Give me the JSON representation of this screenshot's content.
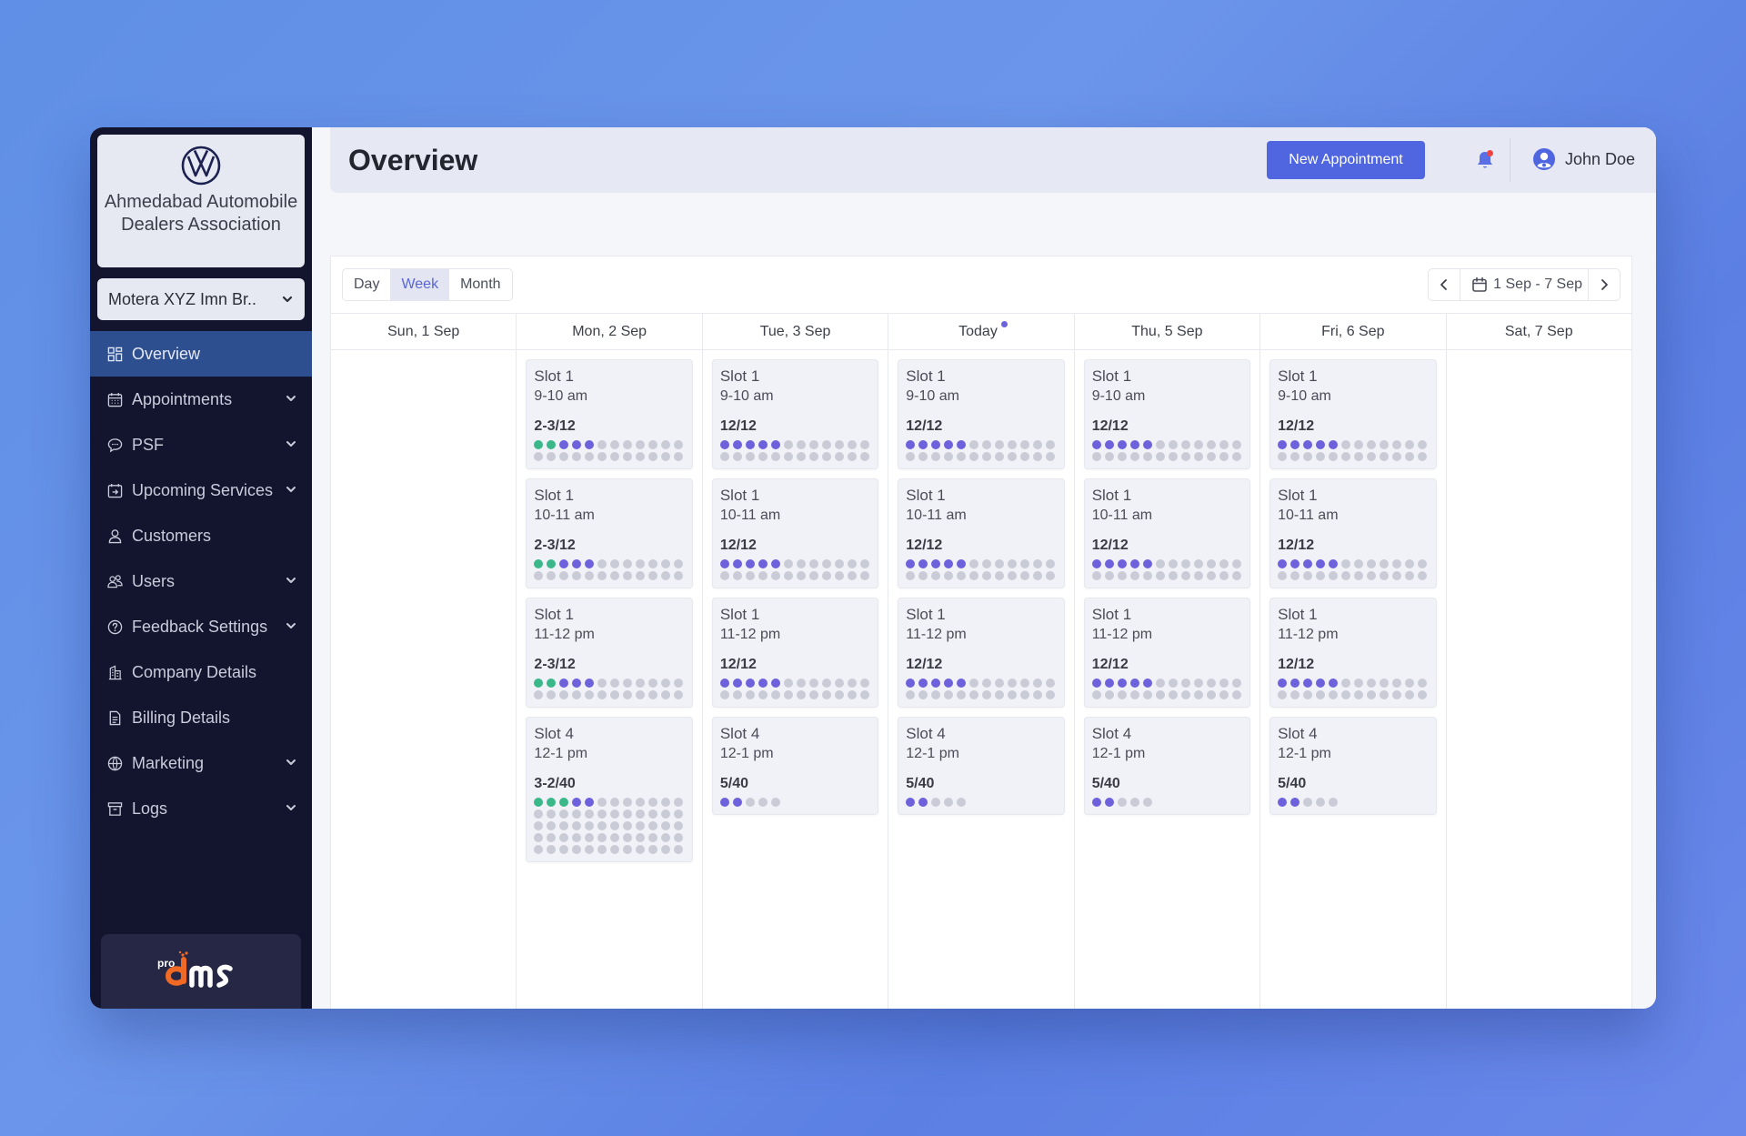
{
  "brand": {
    "logo_icon": "vw-logo-icon",
    "name": "Ahmedabad Automobile Dealers Association"
  },
  "branch_select": {
    "value": "Motera XYZ Imn Br.."
  },
  "sidebar": {
    "items": [
      {
        "label": "Overview",
        "icon": "grid-icon",
        "active": true,
        "has_submenu": false
      },
      {
        "label": "Appointments",
        "icon": "calendar-icon",
        "active": false,
        "has_submenu": true
      },
      {
        "label": "PSF",
        "icon": "chat-bubble-icon",
        "active": false,
        "has_submenu": true
      },
      {
        "label": "Upcoming Services",
        "icon": "calendar-arrow-icon",
        "active": false,
        "has_submenu": true
      },
      {
        "label": "Customers",
        "icon": "user-icon",
        "active": false,
        "has_submenu": false
      },
      {
        "label": "Users",
        "icon": "users-icon",
        "active": false,
        "has_submenu": true
      },
      {
        "label": "Feedback Settings",
        "icon": "question-circle-icon",
        "active": false,
        "has_submenu": true
      },
      {
        "label": "Company Details",
        "icon": "building-icon",
        "active": false,
        "has_submenu": false
      },
      {
        "label": "Billing Details",
        "icon": "document-icon",
        "active": false,
        "has_submenu": false
      },
      {
        "label": "Marketing",
        "icon": "globe-icon",
        "active": false,
        "has_submenu": true
      },
      {
        "label": "Logs",
        "icon": "archive-icon",
        "active": false,
        "has_submenu": true
      }
    ],
    "footer_logo": {
      "prefix": "pro",
      "text": "dms"
    }
  },
  "header": {
    "title": "Overview",
    "new_appointment_label": "New Appointment",
    "notification_icon": "bell-icon",
    "has_notification": true,
    "user_name": "John Doe"
  },
  "calendar": {
    "views": [
      {
        "label": "Day",
        "active": false
      },
      {
        "label": "Week",
        "active": true
      },
      {
        "label": "Month",
        "active": false
      }
    ],
    "date_range": "1 Sep - 7 Sep",
    "days": [
      {
        "label": "Sun, 1 Sep",
        "today": false,
        "slots": []
      },
      {
        "label": "Mon, 2 Sep",
        "today": false,
        "slots": [
          {
            "name": "Slot 1",
            "time": "9-10 am",
            "count": "2-3/12",
            "capacity": 24,
            "green": 2,
            "purple": 3
          },
          {
            "name": "Slot 1",
            "time": "10-11 am",
            "count": "2-3/12",
            "capacity": 24,
            "green": 2,
            "purple": 3
          },
          {
            "name": "Slot 1",
            "time": "11-12 pm",
            "count": "2-3/12",
            "capacity": 24,
            "green": 2,
            "purple": 3
          },
          {
            "name": "Slot 4",
            "time": "12-1 pm",
            "count": "3-2/40",
            "capacity": 60,
            "green": 3,
            "purple": 2
          }
        ]
      },
      {
        "label": "Tue, 3 Sep",
        "today": false,
        "slots": [
          {
            "name": "Slot 1",
            "time": "9-10 am",
            "count": "12/12",
            "capacity": 24,
            "green": 0,
            "purple": 5
          },
          {
            "name": "Slot 1",
            "time": "10-11 am",
            "count": "12/12",
            "capacity": 24,
            "green": 0,
            "purple": 5
          },
          {
            "name": "Slot 1",
            "time": "11-12 pm",
            "count": "12/12",
            "capacity": 24,
            "green": 0,
            "purple": 5
          },
          {
            "name": "Slot 4",
            "time": "12-1 pm",
            "count": "5/40",
            "capacity": 5,
            "green": 0,
            "purple": 2
          }
        ]
      },
      {
        "label": "Today",
        "today": true,
        "slots": [
          {
            "name": "Slot 1",
            "time": "9-10 am",
            "count": "12/12",
            "capacity": 24,
            "green": 0,
            "purple": 5
          },
          {
            "name": "Slot 1",
            "time": "10-11 am",
            "count": "12/12",
            "capacity": 24,
            "green": 0,
            "purple": 5
          },
          {
            "name": "Slot 1",
            "time": "11-12 pm",
            "count": "12/12",
            "capacity": 24,
            "green": 0,
            "purple": 5
          },
          {
            "name": "Slot 4",
            "time": "12-1 pm",
            "count": "5/40",
            "capacity": 5,
            "green": 0,
            "purple": 2
          }
        ]
      },
      {
        "label": "Thu, 5 Sep",
        "today": false,
        "slots": [
          {
            "name": "Slot 1",
            "time": "9-10 am",
            "count": "12/12",
            "capacity": 24,
            "green": 0,
            "purple": 5
          },
          {
            "name": "Slot 1",
            "time": "10-11 am",
            "count": "12/12",
            "capacity": 24,
            "green": 0,
            "purple": 5
          },
          {
            "name": "Slot 1",
            "time": "11-12 pm",
            "count": "12/12",
            "capacity": 24,
            "green": 0,
            "purple": 5
          },
          {
            "name": "Slot 4",
            "time": "12-1 pm",
            "count": "5/40",
            "capacity": 5,
            "green": 0,
            "purple": 2
          }
        ]
      },
      {
        "label": "Fri, 6 Sep",
        "today": false,
        "slots": [
          {
            "name": "Slot 1",
            "time": "9-10 am",
            "count": "12/12",
            "capacity": 24,
            "green": 0,
            "purple": 5
          },
          {
            "name": "Slot 1",
            "time": "10-11 am",
            "count": "12/12",
            "capacity": 24,
            "green": 0,
            "purple": 5
          },
          {
            "name": "Slot 1",
            "time": "11-12 pm",
            "count": "12/12",
            "capacity": 24,
            "green": 0,
            "purple": 5
          },
          {
            "name": "Slot 4",
            "time": "12-1 pm",
            "count": "5/40",
            "capacity": 5,
            "green": 0,
            "purple": 2
          }
        ]
      },
      {
        "label": "Sat, 7 Sep",
        "today": false,
        "slots": []
      }
    ]
  },
  "colors": {
    "accent": "#4f66e0",
    "sidebar_bg": "#13142e",
    "active_nav": "#2e4f8f",
    "dot_green": "#3ab88a",
    "dot_purple": "#6d61dc",
    "dot_empty": "#c9ccd6",
    "notification": "#ef4444"
  }
}
